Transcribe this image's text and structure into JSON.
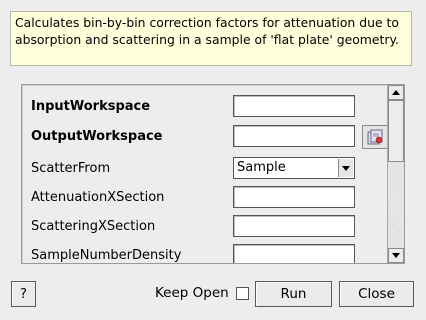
{
  "description": "Calculates bin-by-bin correction factors for attenuation due to absorption and scattering in a sample of 'flat plate' geometry.",
  "properties": [
    {
      "label": "InputWorkspace",
      "bold": true,
      "type": "text",
      "value": ""
    },
    {
      "label": "OutputWorkspace",
      "bold": true,
      "type": "text",
      "value": "",
      "browse_icon": "file-browse-icon"
    },
    {
      "label": "ScatterFrom",
      "bold": false,
      "type": "select",
      "value": "Sample"
    },
    {
      "label": "AttenuationXSection",
      "bold": false,
      "type": "text",
      "value": ""
    },
    {
      "label": "ScatteringXSection",
      "bold": false,
      "type": "text",
      "value": ""
    },
    {
      "label": "SampleNumberDensity",
      "bold": false,
      "type": "text",
      "value": ""
    }
  ],
  "footer": {
    "help_label": "?",
    "keep_open_label": "Keep Open",
    "keep_open_checked": false,
    "run_label": "Run",
    "close_label": "Close"
  }
}
